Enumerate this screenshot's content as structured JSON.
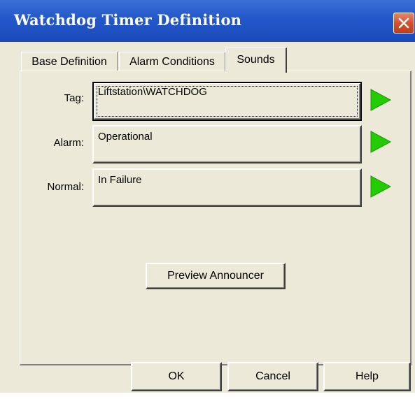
{
  "window": {
    "title": "Watchdog Timer Definition"
  },
  "tabs": [
    {
      "label": "Base Definition",
      "active": false
    },
    {
      "label": "Alarm Conditions",
      "active": false
    },
    {
      "label": "Sounds",
      "active": true
    }
  ],
  "rows": {
    "tag": {
      "label": "Tag:",
      "value": "Liftstation\\WATCHDOG"
    },
    "alarm": {
      "label": "Alarm:",
      "value": "Operational"
    },
    "normal": {
      "label": "Normal:",
      "value": "In Failure"
    }
  },
  "buttons": {
    "preview": "Preview  Announcer",
    "ok": "OK",
    "cancel": "Cancel",
    "help": "Help"
  },
  "icons": {
    "close": "close-icon",
    "play": "play-icon"
  },
  "colors": {
    "titlebar": "#2457c9",
    "face": "#ece9d8",
    "play": "#22cc00",
    "close": "#d5512e"
  }
}
